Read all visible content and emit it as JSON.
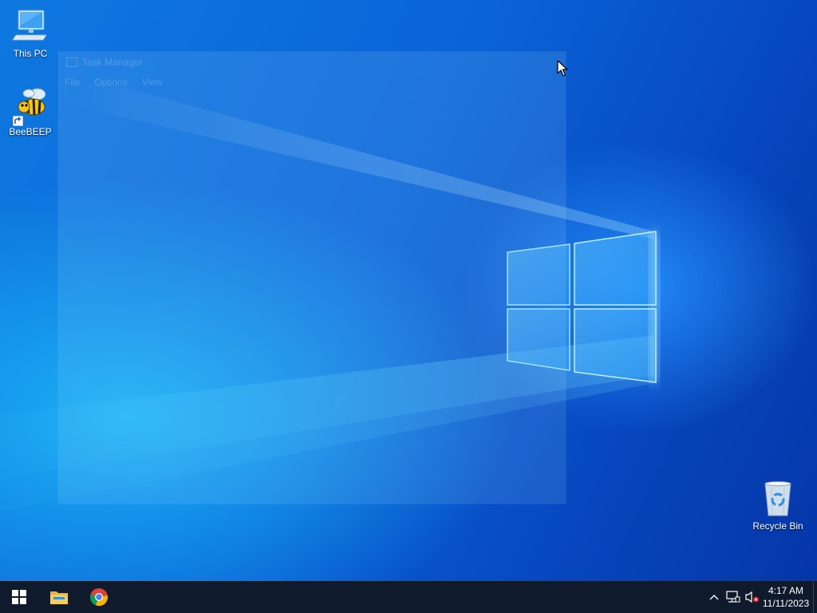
{
  "desktop": {
    "icons": [
      {
        "label": "This PC",
        "icon": "computer-icon"
      },
      {
        "label": "BeeBEEP",
        "icon": "bee-icon"
      },
      {
        "label": "Recycle Bin",
        "icon": "recycle-bin-icon"
      }
    ]
  },
  "ghost_window": {
    "title": "Task Manager",
    "menu": [
      "File",
      "Options",
      "View"
    ]
  },
  "taskbar": {
    "start": {
      "icon": "windows-start-icon"
    },
    "pinned": [
      {
        "name": "File Explorer",
        "icon": "folder-icon"
      },
      {
        "name": "Google Chrome",
        "icon": "chrome-icon"
      }
    ],
    "tray": {
      "icons": [
        "chevron-up-icon",
        "network-icon",
        "speaker-muted-icon"
      ]
    },
    "clock": {
      "time": "4:17 AM",
      "date": "11/11/2023"
    }
  },
  "colors": {
    "taskbar_bg": "#0f1a2c",
    "wallpaper_primary": "#0a64d8",
    "wallpaper_accent": "#1fc8ff"
  }
}
